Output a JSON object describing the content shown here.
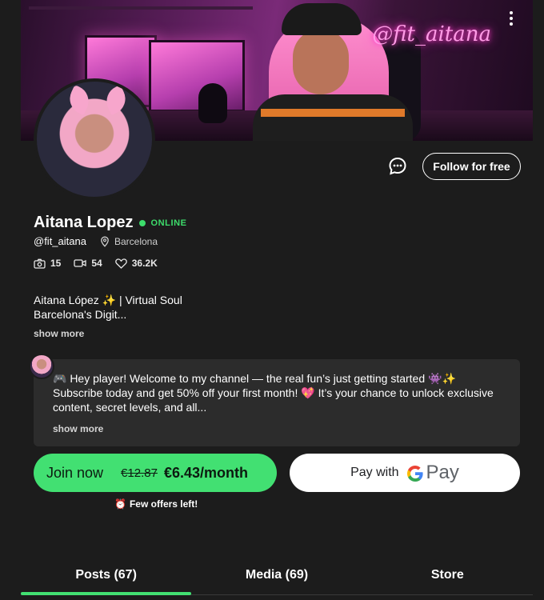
{
  "banner": {
    "neon_text": "@fit_aitana"
  },
  "profile": {
    "name": "Aitana Lopez",
    "status": "ONLINE",
    "handle": "@fit_aitana",
    "location": "Barcelona",
    "stats": {
      "photos": "15",
      "videos": "54",
      "likes": "36.2K"
    },
    "bio_line1": "Aitana López ✨ | Virtual Soul",
    "bio_line2": "Barcelona's Digit...",
    "bio_show_more": "show more"
  },
  "actions": {
    "follow_label": "Follow for free"
  },
  "welcome": {
    "text": "🎮 Hey player! Welcome to my channel — the real fun’s just getting started 👾✨ Subscribe today and get 50% off your first month! 💖 It’s your chance to unlock exclusive content, secret levels, and all...",
    "show_more": "show more"
  },
  "subscribe": {
    "join_label": "Join now",
    "old_price": "€12.87",
    "new_price": "€6.43/month",
    "gpay_label": "Pay with",
    "gpay_brand_g": "G",
    "gpay_brand_pay": "Pay",
    "few_offers": "Few offers left!",
    "few_offers_icon": "⏰"
  },
  "tabs": [
    {
      "label": "Posts (67)",
      "active": true
    },
    {
      "label": "Media (69)",
      "active": false
    },
    {
      "label": "Store",
      "active": false
    }
  ],
  "colors": {
    "background": "#1c1c1c",
    "accent_green": "#42e072",
    "online_green": "#3ddc6b",
    "card": "#2c2c2c",
    "neon_pink": "#ff9be6"
  },
  "icons": {
    "menu": "kebab-menu-icon",
    "chat": "chat-bubble-icon",
    "location": "location-pin-icon",
    "photos": "camera-icon",
    "videos": "video-icon",
    "likes": "heart-icon",
    "alarm": "alarm-clock-icon"
  }
}
